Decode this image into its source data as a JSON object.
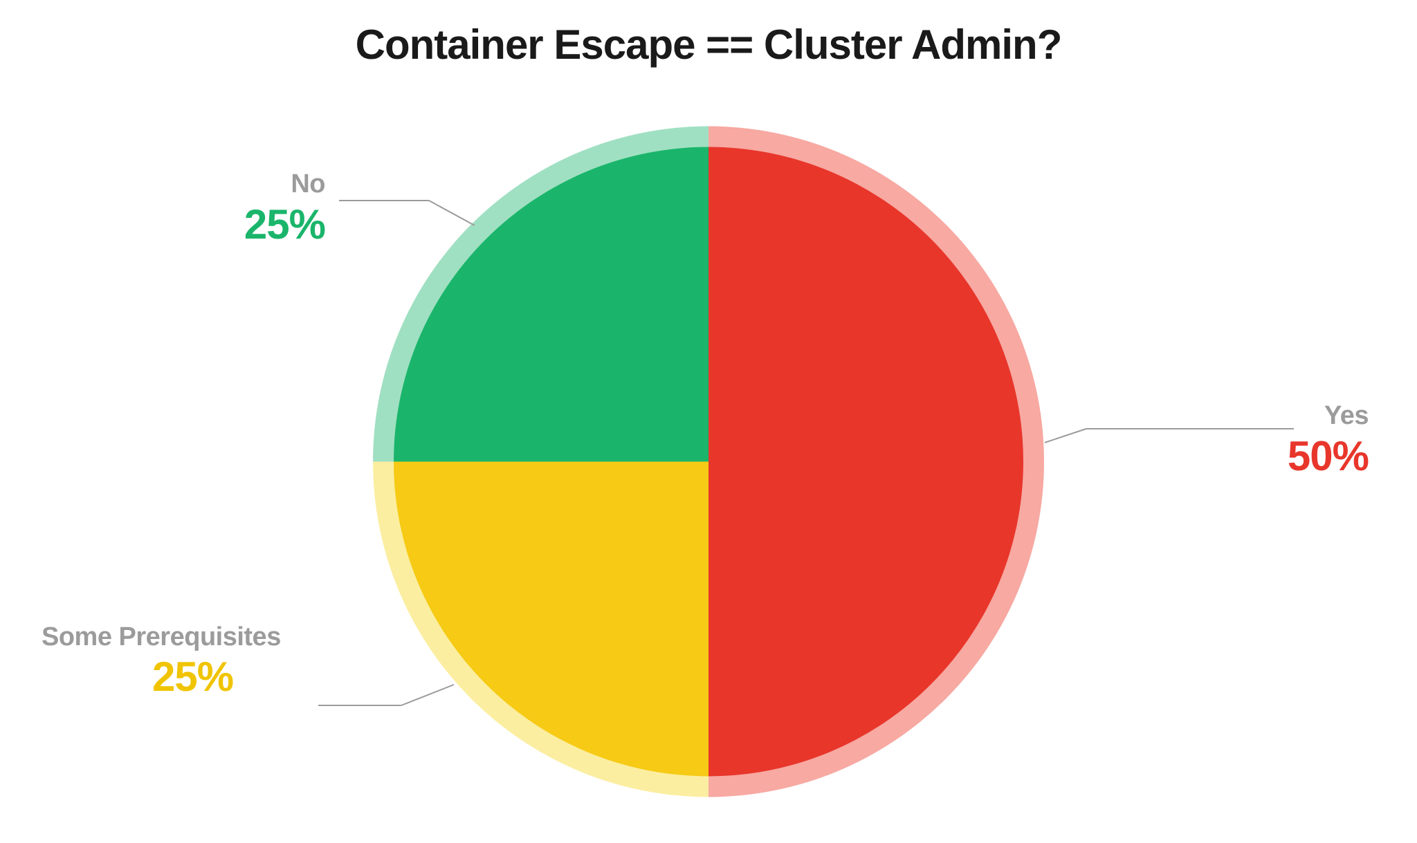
{
  "chart_data": {
    "type": "pie",
    "title": "Container Escape == Cluster Admin?",
    "series": [
      {
        "name": "Yes",
        "value": 50,
        "color": "#e8362b",
        "halo": "#f7a9a2",
        "display": "50%"
      },
      {
        "name": "Some Prerequisites",
        "value": 25,
        "color": "#f6ca15",
        "halo": "#fbeea0",
        "display": "25%"
      },
      {
        "name": "No",
        "value": 25,
        "color": "#1ab56b",
        "halo": "#a0e0c2",
        "display": "25%"
      }
    ]
  }
}
